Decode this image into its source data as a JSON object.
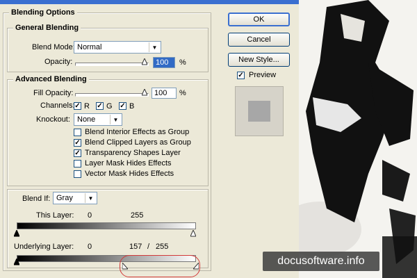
{
  "dialog": {
    "section_title": "Blending Options"
  },
  "general": {
    "title": "General Blending",
    "blend_mode_label": "Blend Mode:",
    "blend_mode_value": "Normal",
    "opacity_label": "Opacity:",
    "opacity_value": "100",
    "opacity_unit": "%"
  },
  "advanced": {
    "title": "Advanced Blending",
    "fill_opacity_label": "Fill Opacity:",
    "fill_opacity_value": "100",
    "fill_opacity_unit": "%",
    "channels_label": "Channels:",
    "channels": [
      {
        "label": "R",
        "checked": true
      },
      {
        "label": "G",
        "checked": true
      },
      {
        "label": "B",
        "checked": true
      }
    ],
    "knockout_label": "Knockout:",
    "knockout_value": "None",
    "options": [
      {
        "label": "Blend Interior Effects as Group",
        "checked": false
      },
      {
        "label": "Blend Clipped Layers as Group",
        "checked": true
      },
      {
        "label": "Transparency Shapes Layer",
        "checked": true
      },
      {
        "label": "Layer Mask Hides Effects",
        "checked": false
      },
      {
        "label": "Vector Mask Hides Effects",
        "checked": false
      }
    ]
  },
  "blend_if": {
    "label": "Blend If:",
    "value": "Gray",
    "this_layer_label": "This Layer:",
    "this_layer_low": "0",
    "this_layer_high": "255",
    "underlying_label": "Underlying Layer:",
    "underlying_low": "0",
    "underlying_split_low": "157",
    "underlying_sep": "/",
    "underlying_high": "255"
  },
  "buttons": {
    "ok": "OK",
    "cancel": "Cancel",
    "new_style": "New Style...",
    "preview_label": "Preview",
    "preview_checked": true
  },
  "watermark": "docusoftware.info",
  "colors": {
    "accent": "#3a6fd0",
    "highlight": "#d23a3a",
    "dialog_bg": "#ece9d8"
  }
}
